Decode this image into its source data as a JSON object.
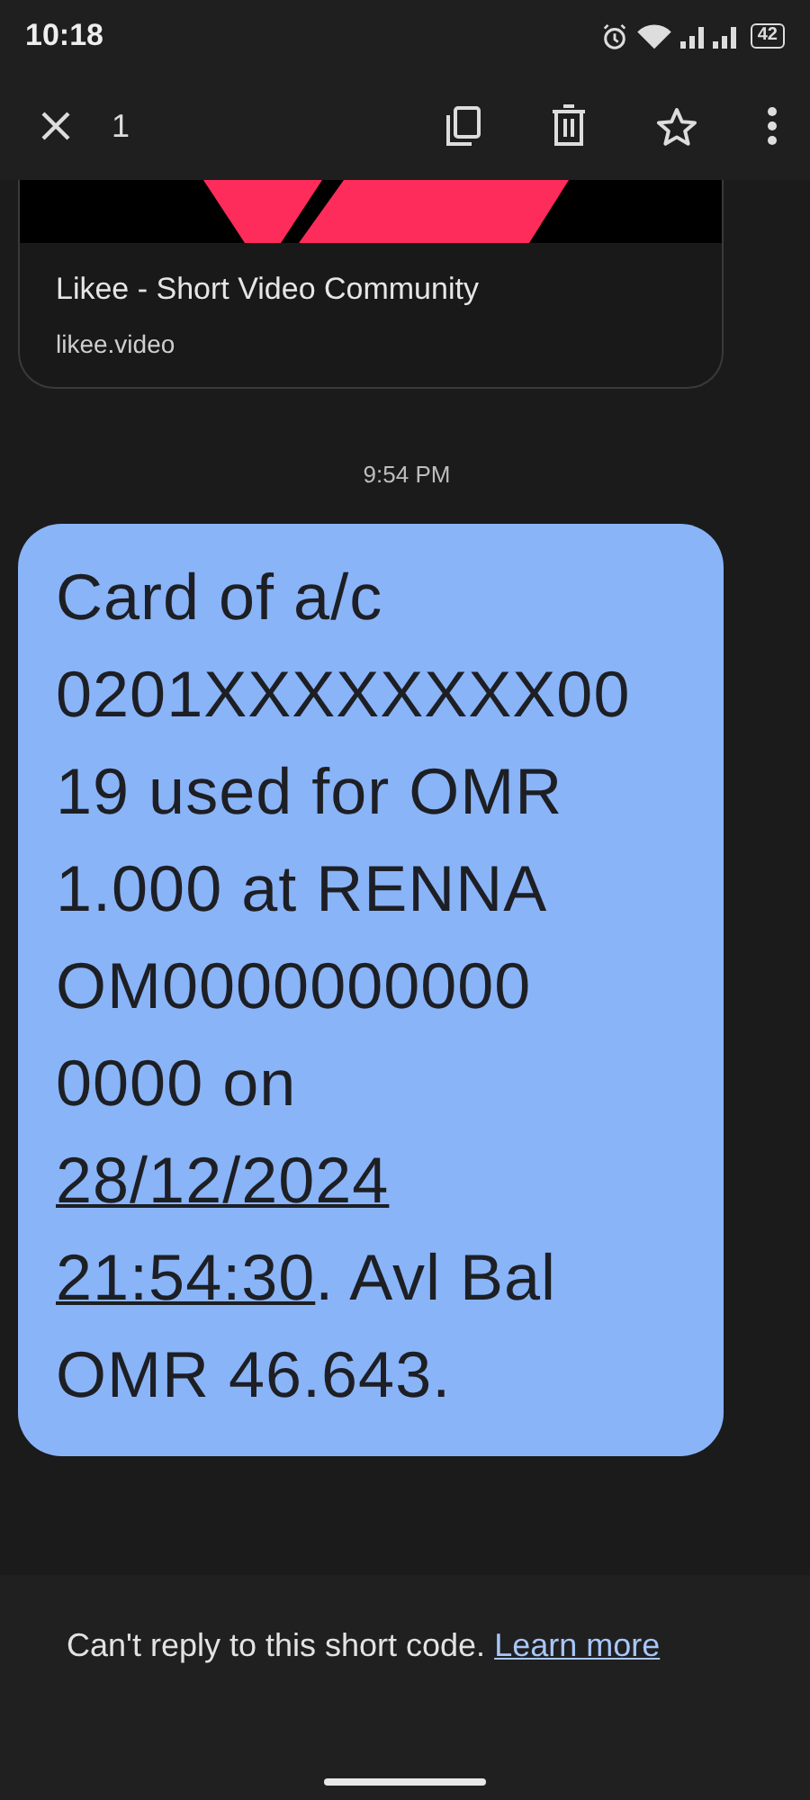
{
  "status_bar": {
    "time": "10:18",
    "battery": "42"
  },
  "toolbar": {
    "selected_count": "1"
  },
  "link_preview": {
    "title": "Likee - Short Video Community",
    "domain": "likee.video"
  },
  "timestamp": "9:54 PM",
  "message": {
    "parts": [
      {
        "kind": "text",
        "text": "Card of a/c\n0201XXXXXXXX00\n19 used for OMR\n1.000 at RENNA\nOM0000000000\n0000 on\n"
      },
      {
        "kind": "link",
        "text": "28/12/2024"
      },
      {
        "kind": "break"
      },
      {
        "kind": "link",
        "text": "21:54:30"
      },
      {
        "kind": "text",
        "text": ". Avl Bal\nOMR 46.643."
      }
    ]
  },
  "footer": {
    "notice": "Can't reply to this short code.",
    "link": "Learn more"
  }
}
